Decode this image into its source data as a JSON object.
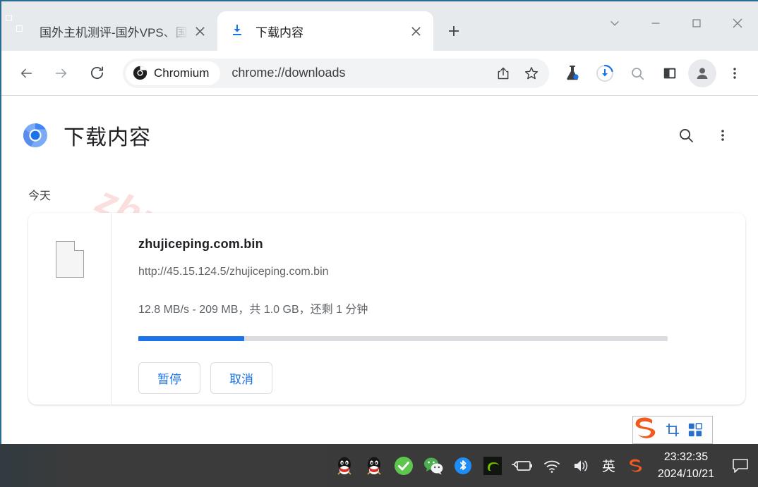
{
  "window": {
    "controls": [
      {
        "name": "tab-search",
        "glyph": "chevron-down"
      },
      {
        "name": "minimize",
        "glyph": "minus"
      },
      {
        "name": "maximize",
        "glyph": "square"
      },
      {
        "name": "close",
        "glyph": "cross"
      }
    ]
  },
  "tabs": [
    {
      "title": "国外主机测评-国外VPS、国",
      "favicon": "seal-favicon",
      "active": false,
      "close_label": "✕"
    },
    {
      "title": "下载内容",
      "favicon": "download-icon",
      "active": true,
      "close_label": "✕"
    }
  ],
  "newtab_label": "+",
  "toolbar": {
    "back_label": "←",
    "forward_label": "→",
    "reload_label": "⟳",
    "chip_label": "Chromium",
    "url": "chrome://downloads",
    "icons": [
      "share-icon",
      "bookmark-star-icon",
      "experiments-flask-icon",
      "download-progress-icon",
      "search-icon",
      "side-panel-icon",
      "profile-avatar-icon",
      "browser-menu-icon"
    ]
  },
  "page": {
    "title": "下载内容",
    "logo": "chromium-logo",
    "search_label": "search-icon",
    "menu_label": "more-vert-icon",
    "section_label": "今天",
    "watermark": "zhujiceping.com",
    "download": {
      "file_icon": "generic-file-icon",
      "filename": "zhujiceping.com.bin",
      "url": "http://45.15.124.5/zhujiceping.com.bin",
      "status": "12.8 MB/s - 209 MB，共 1.0 GB，还剩 1 分钟",
      "progress_percent": 20,
      "pause_label": "暂停",
      "cancel_label": "取消",
      "progress_color": "#1a73e8",
      "track_color": "#dadce0"
    }
  },
  "sogou_toolbar": {
    "logo": "sogou-s-logo",
    "screenshot_label": "crop-screenshot-icon",
    "grid_label": "app-grid-icon"
  },
  "taskbar": {
    "tray": [
      "qq-icon",
      "qq-icon",
      "security-check-icon",
      "wechat-icon",
      "bluetooth-icon",
      "nvidia-icon",
      "battery-icon",
      "wifi-icon",
      "volume-icon"
    ],
    "ime_label": "英",
    "sogou_label": "sogou-icon",
    "time": "23:32:35",
    "date": "2024/10/21",
    "notification_label": "action-center-icon"
  }
}
